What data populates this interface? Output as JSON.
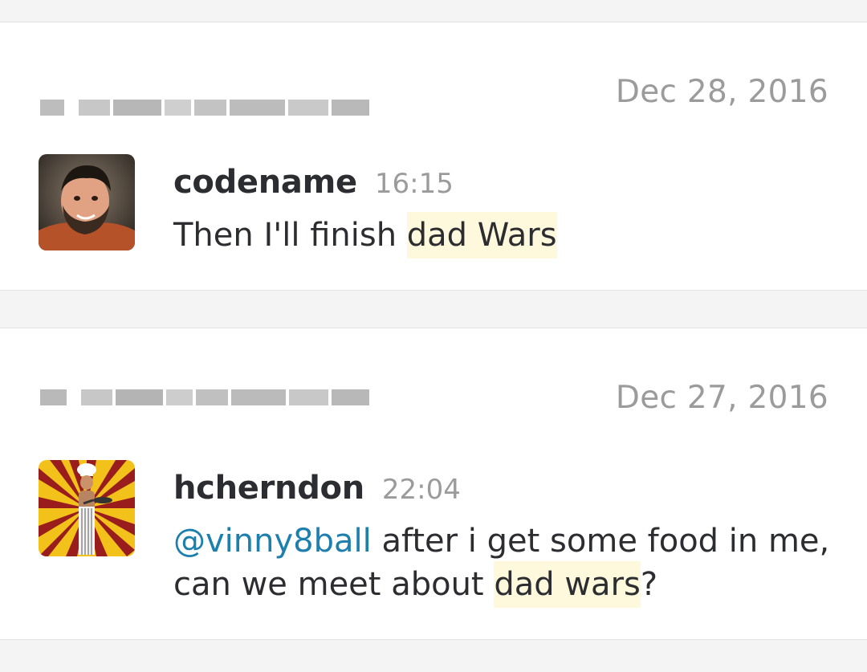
{
  "messages": [
    {
      "date": "Dec 28, 2016",
      "author": "codename",
      "time": "16:15",
      "text_before": "Then I'll finish ",
      "highlight": "dad Wars",
      "avatar_icon": "user-photo-avatar"
    },
    {
      "date": "Dec 27, 2016",
      "author": "hcherndon",
      "time": "22:04",
      "mention": "@vinny8ball",
      "text_before": " after i get some food in me, can we meet about ",
      "highlight": "dad wars",
      "text_after": "?",
      "avatar_icon": "chef-sunburst-avatar"
    }
  ],
  "colors": {
    "highlight": "#fef9dc",
    "mention": "#1d7fae",
    "muted": "#9b9b9b",
    "text": "#2c2d30"
  }
}
